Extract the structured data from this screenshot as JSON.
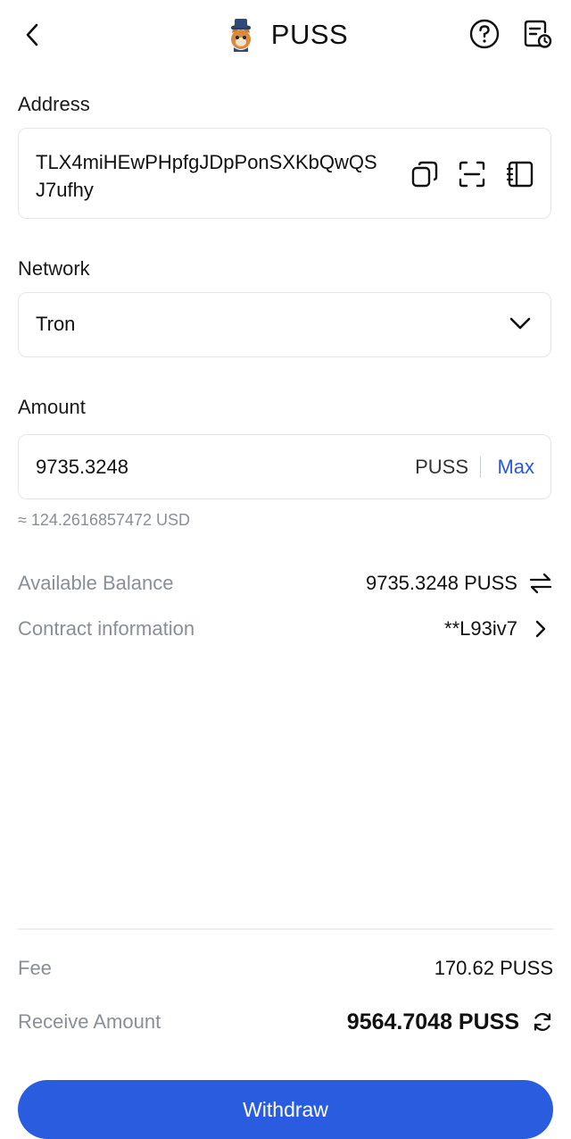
{
  "header": {
    "title": "PUSS",
    "icons": [
      "back-chevron-icon",
      "cat-token-logo",
      "help-circle-icon",
      "history-document-icon"
    ]
  },
  "address": {
    "label": "Address",
    "value": "TLX4miHEwPHpfgJDpPonSXKbQwQSJ7ufhy",
    "icons": [
      "copy-icon",
      "scan-icon",
      "address-book-icon"
    ]
  },
  "network": {
    "label": "Network",
    "value": "Tron",
    "icon": "chevron-down-icon"
  },
  "amount": {
    "label": "Amount",
    "value": "9735.3248",
    "unit": "PUSS",
    "max_label": "Max",
    "usd_estimate": "≈ 124.2616857472 USD"
  },
  "details": {
    "available_balance_label": "Available Balance",
    "available_balance_value": "9735.3248 PUSS",
    "contract_label": "Contract information",
    "contract_value": "**L93iv7"
  },
  "summary": {
    "fee_label": "Fee",
    "fee_value": "170.62 PUSS",
    "receive_label": "Receive Amount",
    "receive_value": "9564.7048 PUSS"
  },
  "actions": {
    "withdraw_label": "Withdraw"
  },
  "colors": {
    "accent": "#2a5ce0",
    "max_link": "#2b59d9",
    "muted_text": "#8a8e95",
    "border": "#e3e5e8"
  }
}
